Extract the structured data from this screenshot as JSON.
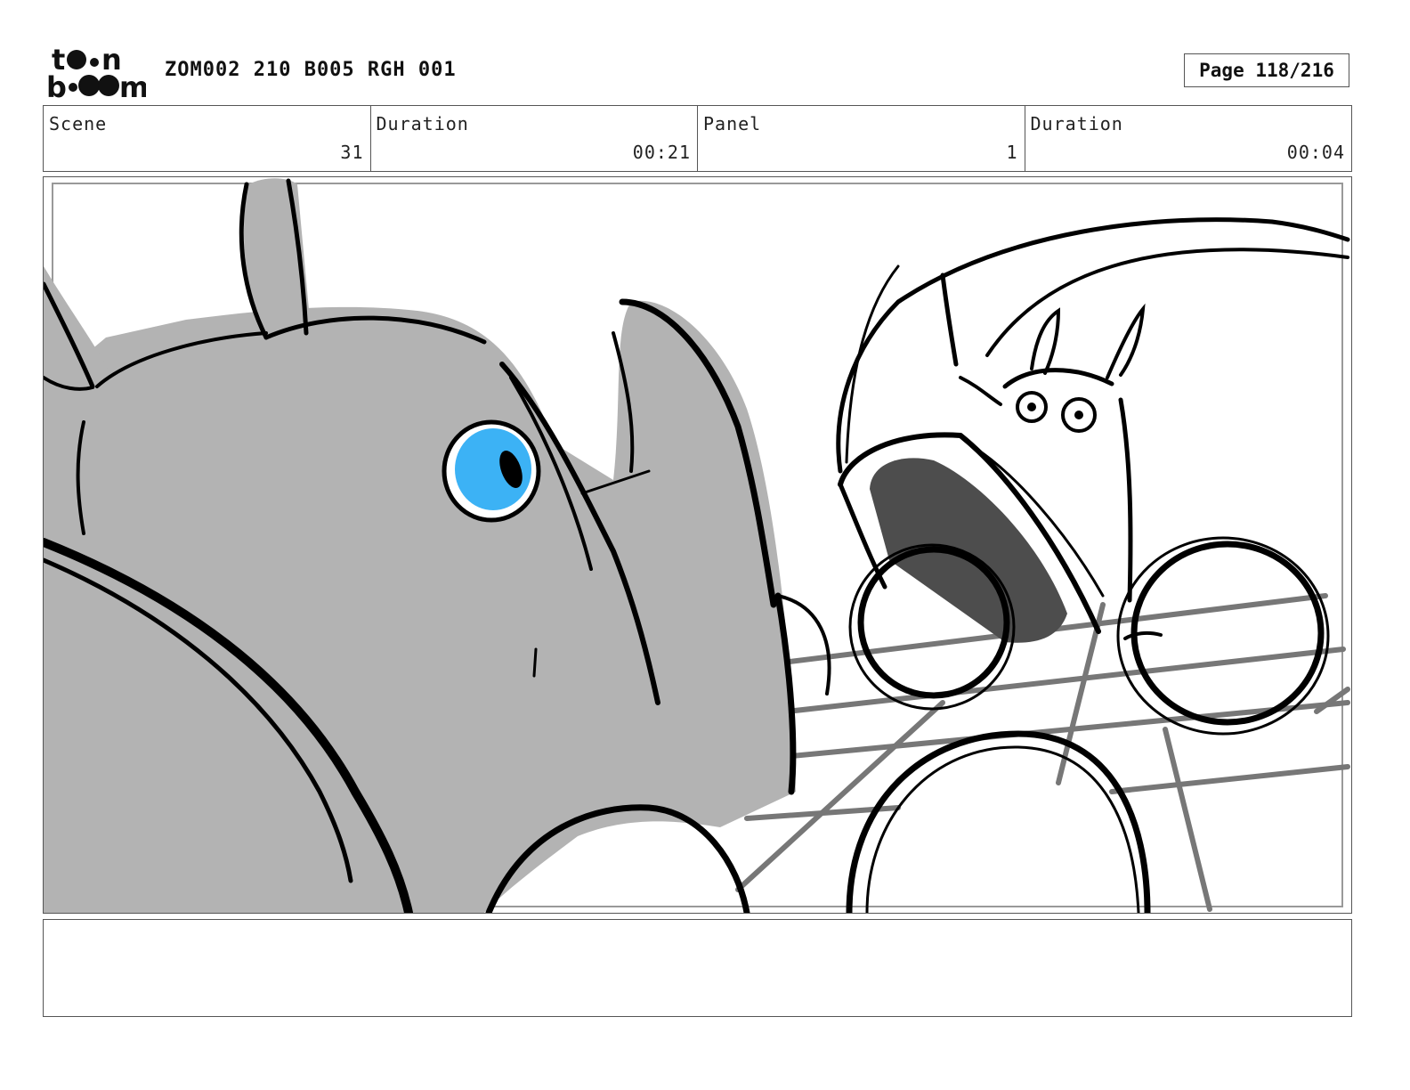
{
  "header": {
    "logo_text": "toon boom",
    "title": "ZOM002 210 B005 RGH 001",
    "page_label": "Page 118/216"
  },
  "info": [
    {
      "label": "Scene",
      "value": "31"
    },
    {
      "label": "Duration",
      "value": "00:21"
    },
    {
      "label": "Panel",
      "value": "1"
    },
    {
      "label": "Duration",
      "value": "00:04"
    }
  ],
  "panel": {
    "eye_color": "#3cb2f5",
    "body_color": "#b3b3b3",
    "mouth_color": "#4d4d4d"
  },
  "notes": {
    "text": ""
  }
}
